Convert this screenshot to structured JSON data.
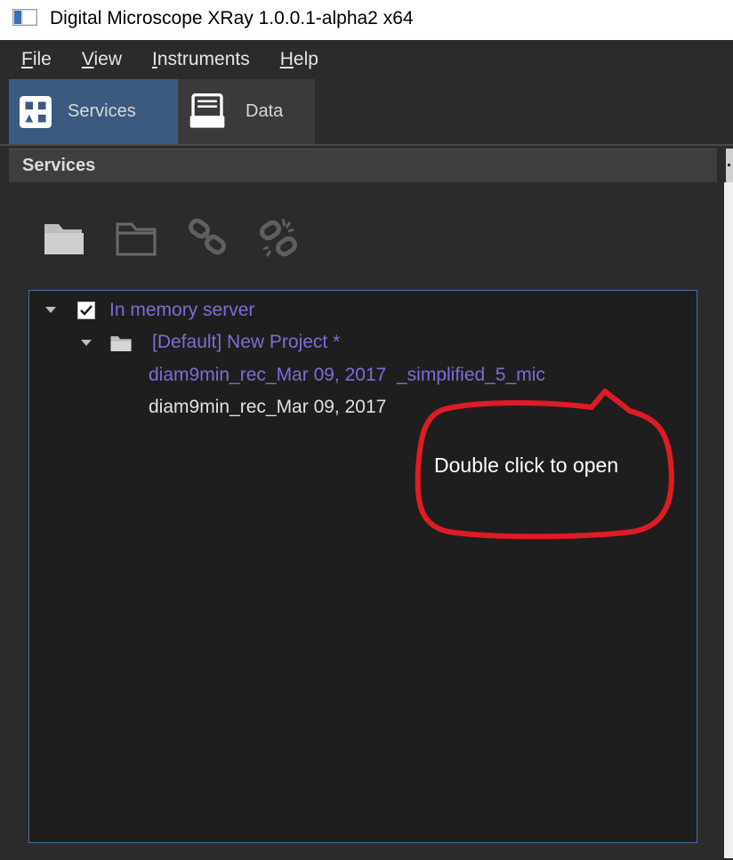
{
  "window": {
    "title": "Digital Microscope XRay 1.0.0.1-alpha2 x64"
  },
  "menubar": {
    "items": [
      {
        "label": "File",
        "underline": "F"
      },
      {
        "label": "View",
        "underline": "V"
      },
      {
        "label": "Instruments",
        "underline": "I"
      },
      {
        "label": "Help",
        "underline": "H"
      }
    ]
  },
  "tabs": [
    {
      "label": "Services",
      "icon": "services-grid-icon",
      "active": true
    },
    {
      "label": "Data",
      "icon": "data-tray-icon",
      "active": false
    }
  ],
  "panel": {
    "title": "Services"
  },
  "toolbar": {
    "icons": [
      "folder-filled-icon",
      "folder-outline-icon",
      "link-icon",
      "unlink-icon"
    ]
  },
  "tree": {
    "server": {
      "label": "In memory server",
      "checked": true,
      "expanded": true
    },
    "project": {
      "label": "[Default] New Project *",
      "expanded": true
    },
    "items": [
      {
        "label": "diam9min_rec_Mar 09, 2017  _simplified_5_mic",
        "style": "link"
      },
      {
        "label": "diam9min_rec_Mar 09, 2017",
        "style": "plain"
      }
    ]
  },
  "annotation": {
    "text": "Double click to open",
    "color": "#e01b24"
  },
  "colors": {
    "accent_tab": "#3c5a80",
    "link": "#7b6ed6",
    "background": "#2b2b2b"
  }
}
